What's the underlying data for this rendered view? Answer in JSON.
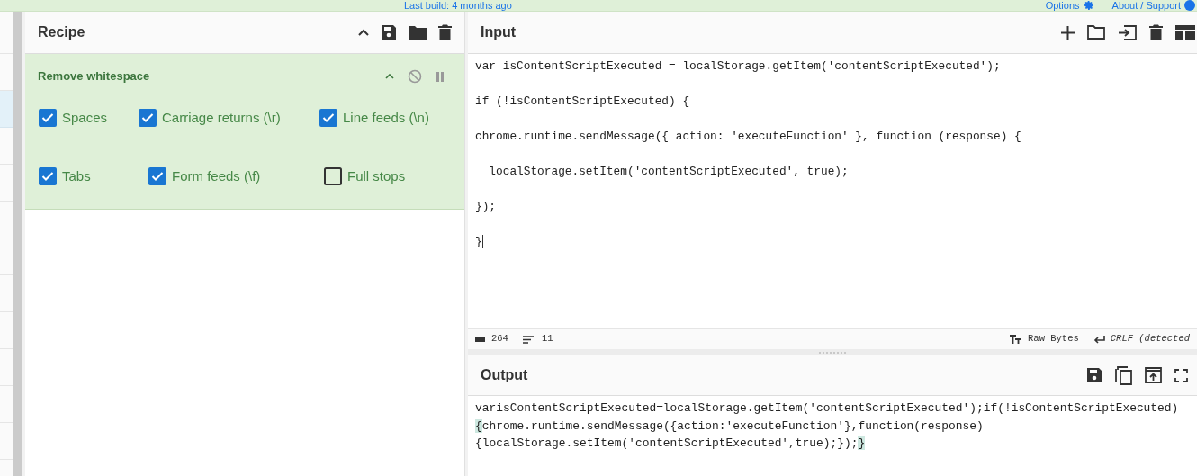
{
  "top_bar": {
    "build_info": "Last build: 4 months ago",
    "options": "Options",
    "about": "About / Support"
  },
  "recipe": {
    "title": "Recipe",
    "operation": {
      "name": "Remove whitespace",
      "options": [
        {
          "label": "Spaces",
          "checked": true
        },
        {
          "label": "Carriage returns (\\r)",
          "checked": true
        },
        {
          "label": "Line feeds (\\n)",
          "checked": true
        },
        {
          "label": "Tabs",
          "checked": true
        },
        {
          "label": "Form feeds (\\f)",
          "checked": true
        },
        {
          "label": "Full stops",
          "checked": false
        }
      ]
    }
  },
  "input": {
    "title": "Input",
    "lines": [
      "var isContentScriptExecuted = localStorage.getItem('contentScriptExecuted');",
      "if (!isContentScriptExecuted) {",
      "chrome.runtime.sendMessage({ action: 'executeFunction' }, function (response) {",
      "  localStorage.setItem('contentScriptExecuted', true);",
      "});",
      "}"
    ],
    "status": {
      "chars": "264",
      "lines": "11",
      "encoding": "Raw Bytes",
      "eol": "CRLF (detected"
    }
  },
  "output": {
    "title": "Output",
    "lines": [
      [
        {
          "text": "varisContentScriptExecuted=localStorage.getItem('contentScriptExecuted');if(!isContentScriptExecuted)",
          "highlighted": false
        }
      ],
      [
        {
          "text": "{",
          "highlighted": true
        },
        {
          "text": "chrome.runtime.sendMessage({action:'executeFunction'},function(response)",
          "highlighted": false
        }
      ],
      [
        {
          "text": "{localStorage.setItem('contentScriptExecuted',true);});",
          "highlighted": false
        },
        {
          "text": "}",
          "highlighted": true
        }
      ]
    ]
  }
}
